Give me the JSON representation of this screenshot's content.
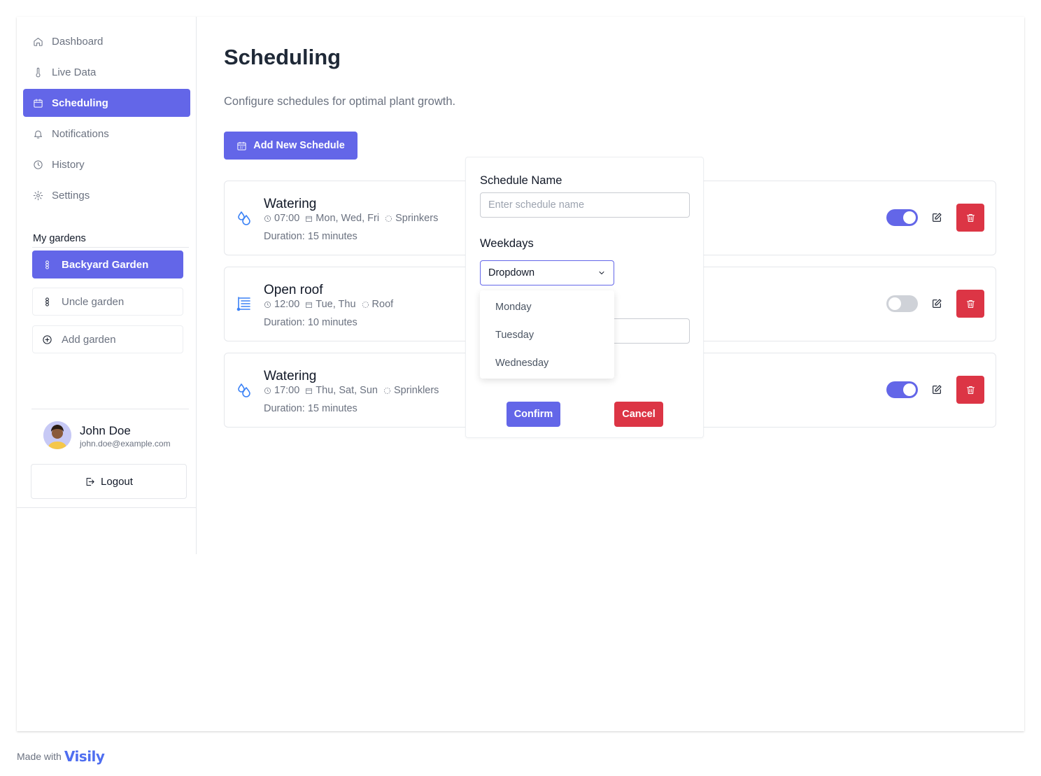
{
  "sidebar": {
    "nav": [
      {
        "label": "Dashboard",
        "icon": "home-icon"
      },
      {
        "label": "Live Data",
        "icon": "thermometer-icon"
      },
      {
        "label": "Scheduling",
        "icon": "calendar-icon"
      },
      {
        "label": "Notifications",
        "icon": "bell-icon"
      },
      {
        "label": "History",
        "icon": "clock-icon"
      },
      {
        "label": "Settings",
        "icon": "gear-icon"
      }
    ],
    "active_nav": "Scheduling",
    "gardens_title": "My gardens",
    "gardens": [
      {
        "label": "Backyard Garden",
        "icon": "flower-icon"
      },
      {
        "label": "Uncle garden",
        "icon": "flower-icon"
      },
      {
        "label": "Add garden",
        "icon": "plus-circle-icon"
      }
    ],
    "user": {
      "name": "John Doe",
      "email": "john.doe@example.com"
    },
    "logout_label": "Logout"
  },
  "main": {
    "title": "Scheduling",
    "subtitle": "Configure schedules for optimal plant growth.",
    "add_button": "Add New Schedule",
    "schedules": [
      {
        "title": "Watering",
        "time": "07:00",
        "days": "Mon, Wed, Fri",
        "device": "Sprinkers",
        "duration": "Duration: 15 minutes",
        "icon": "droplets-icon",
        "enabled": true
      },
      {
        "title": "Open roof",
        "time": "12:00",
        "days": "Tue, Thu",
        "device": "Roof",
        "duration": "Duration: 10 minutes",
        "icon": "roof-icon",
        "enabled": false
      },
      {
        "title": "Watering",
        "time": "17:00",
        "days": "Thu, Sat, Sun",
        "device": "Sprinklers",
        "duration": "Duration: 15 minutes",
        "icon": "droplets-icon",
        "enabled": true
      }
    ]
  },
  "modal": {
    "name_label": "Schedule Name",
    "name_placeholder": "Enter schedule name",
    "weekdays_label": "Weekdays",
    "dropdown_value": "Dropdown",
    "dropdown_options": [
      "Monday",
      "Tuesday",
      "Wednesday"
    ],
    "confirm_label": "Confirm",
    "cancel_label": "Cancel"
  },
  "footer": {
    "made_with": "Made with",
    "brand": "Visily"
  },
  "colors": {
    "accent": "#6366e8",
    "danger": "#dc3545",
    "icon_blue": "#3b82f6"
  }
}
